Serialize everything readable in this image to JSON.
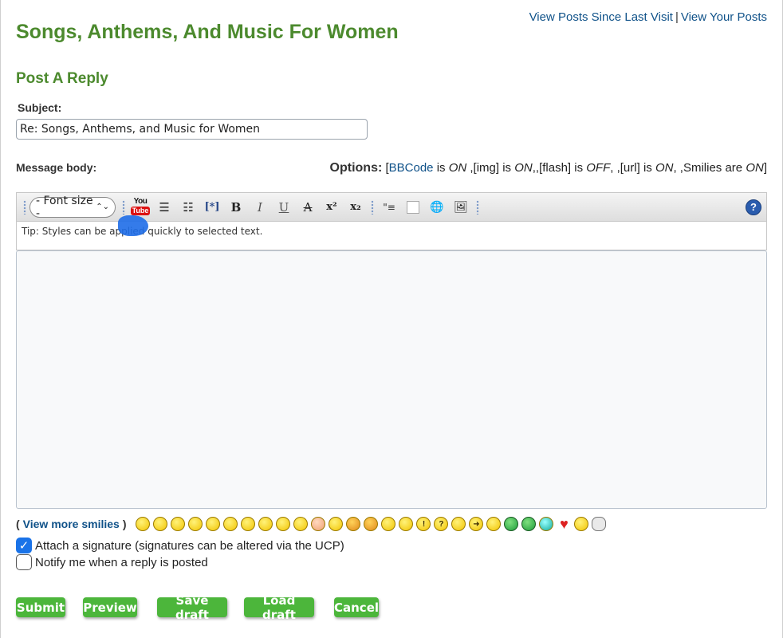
{
  "header": {
    "links": [
      {
        "label": "View Posts Since Last Visit"
      },
      {
        "label": "View Your Posts"
      }
    ],
    "separator": "|",
    "forum_title": "Songs, Anthems, And Music For Women",
    "post_heading": "Post A Reply"
  },
  "subject": {
    "label": "Subject:",
    "value": "Re: Songs, Anthems, and Music for Women"
  },
  "message": {
    "label": "Message body:",
    "value": ""
  },
  "options": {
    "title": "Options:",
    "bbcode_link": "BBCode",
    "bbcode_is": "is",
    "bbcode_state": "ON",
    "img_text": ",[img] is",
    "img_state": "ON",
    "flash_text": ",,[flash] is",
    "flash_state": "OFF",
    "url_text": ", ,[url] is",
    "url_state": "ON",
    "smilies_text": ", ,Smilies are",
    "smilies_state": "ON",
    "open_bracket": "[",
    "close_bracket": "]"
  },
  "toolbar": {
    "font_size_label": "- Font size -",
    "font_size_arrow": "⌃⌄",
    "youtube_top": "You",
    "youtube_bottom": "Tube",
    "help_label": "?",
    "buttons": [
      {
        "icon": "bullet-list-icon",
        "glyph": "☰"
      },
      {
        "icon": "numbered-list-icon",
        "glyph": "☷"
      },
      {
        "icon": "list-item-icon",
        "glyph": "[*]"
      },
      {
        "icon": "bold-icon",
        "glyph": "B"
      },
      {
        "icon": "italic-icon",
        "glyph": "I"
      },
      {
        "icon": "underline-icon",
        "glyph": "U"
      },
      {
        "icon": "strikethrough-icon",
        "glyph": "A"
      },
      {
        "icon": "superscript-icon",
        "glyph": "x²"
      },
      {
        "icon": "subscript-icon",
        "glyph": "x₂"
      },
      {
        "icon": "quote-icon",
        "glyph": "\"≡"
      },
      {
        "icon": "color-icon",
        "glyph": ""
      },
      {
        "icon": "link-icon",
        "glyph": "🌐"
      },
      {
        "icon": "image-icon",
        "glyph": "🖼"
      }
    ]
  },
  "tip": {
    "text": "Tip: Styles can be applied quickly to selected text."
  },
  "smilies": {
    "open": "(",
    "link_label": "View more smilies",
    "close": ")",
    "items": [
      {
        "icon": "biggrin-icon",
        "face": "😁"
      },
      {
        "icon": "smile-icon",
        "face": "☺"
      },
      {
        "icon": "sad-icon",
        "face": "☹"
      },
      {
        "icon": "surprised-icon",
        "face": "o"
      },
      {
        "icon": "eek-icon",
        "face": "◎"
      },
      {
        "icon": "confused-icon",
        "face": "~"
      },
      {
        "icon": "cool-icon",
        "face": "■"
      },
      {
        "icon": "lol-icon",
        "face": "D"
      },
      {
        "icon": "mad-icon",
        "face": "ʘ"
      },
      {
        "icon": "razz-icon",
        "face": "P"
      },
      {
        "icon": "redface-icon",
        "face": "•"
      },
      {
        "icon": "cry-icon",
        "face": "T"
      },
      {
        "icon": "evil-icon",
        "face": "ᵛ"
      },
      {
        "icon": "twisted-icon",
        "face": "ᵛ"
      },
      {
        "icon": "rolleyes-icon",
        "face": "◔"
      },
      {
        "icon": "wink-icon",
        "face": ";"
      },
      {
        "icon": "exclaim-icon",
        "face": "!"
      },
      {
        "icon": "question-icon",
        "face": "?"
      },
      {
        "icon": "idea-icon",
        "face": "ϙ"
      },
      {
        "icon": "arrow-icon",
        "face": "➜"
      },
      {
        "icon": "neutral-icon",
        "face": "–"
      },
      {
        "icon": "grin-green-icon",
        "face": "▦"
      },
      {
        "icon": "angry-icon",
        "face": "▩"
      },
      {
        "icon": "jester-icon",
        "face": "♣"
      },
      {
        "icon": "heart-icon",
        "face": "♥"
      },
      {
        "icon": "thumbs-icon",
        "face": "b"
      },
      {
        "icon": "skull-icon",
        "face": "☠"
      }
    ]
  },
  "checkboxes": {
    "attach_signature": {
      "label": "Attach a signature (signatures can be altered via the UCP)",
      "checked": true,
      "mark": "✓"
    },
    "notify_reply": {
      "label": "Notify me when a reply is posted",
      "checked": false,
      "mark": ""
    }
  },
  "actions": {
    "submit": "Submit",
    "preview": "Preview",
    "save_draft": "Save draft",
    "load_draft": "Load draft",
    "cancel": "Cancel"
  }
}
